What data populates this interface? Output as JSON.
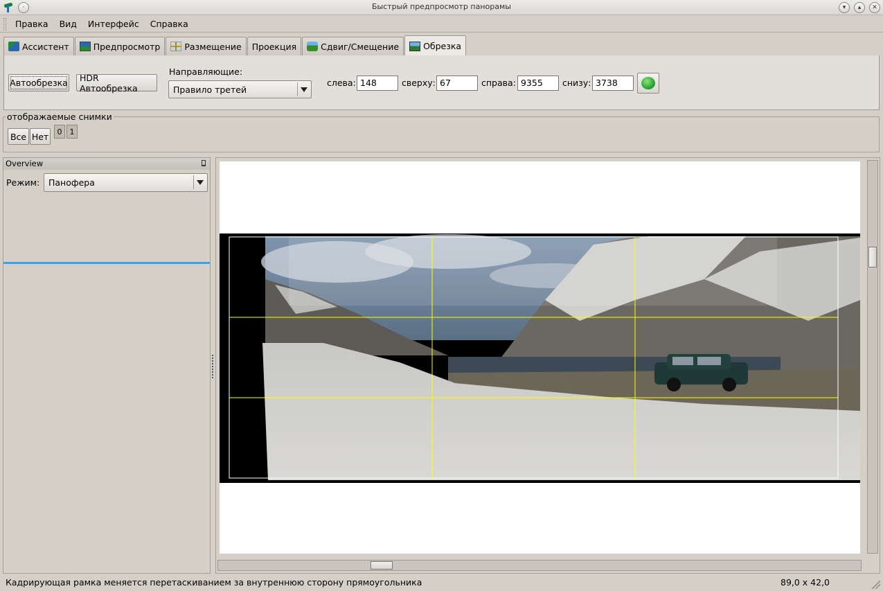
{
  "window": {
    "title": "Быстрый предпросмотр панорамы",
    "app_icon": "hugin-icon",
    "controls": [
      "minimize-icon",
      "maximize-icon",
      "close-icon"
    ]
  },
  "menu": {
    "items": [
      "Правка",
      "Вид",
      "Интерфейс",
      "Справка"
    ]
  },
  "tabs": [
    {
      "label": "Ассистент",
      "icon": "wizard-icon"
    },
    {
      "label": "Предпросмотр",
      "icon": "gl-preview-icon"
    },
    {
      "label": "Размещение",
      "icon": "layout-grid-icon"
    },
    {
      "label": "Проекция",
      "icon": ""
    },
    {
      "label": "Сдвиг/Смещение",
      "icon": "move-icon"
    },
    {
      "label": "Обрезка",
      "icon": "crop-icon",
      "active": true
    }
  ],
  "crop": {
    "autocrop_label": "Автообрезка",
    "hdr_autocrop_label": "HDR Автообрезка",
    "guides_label": "Направляющие:",
    "guides_value": "Правило третей",
    "left_label": "слева:",
    "left_value": "148",
    "top_label": "сверху:",
    "top_value": "67",
    "right_label": "справа:",
    "right_value": "9355",
    "bottom_label": "снизу:",
    "bottom_value": "3738",
    "reset_icon": "green-refresh-icon"
  },
  "displayed_images": {
    "legend": "отображаемые снимки",
    "all_label": "Все",
    "none_label": "Нет",
    "images": [
      "0",
      "1"
    ]
  },
  "overview": {
    "title": "Overview",
    "mode_label": "Режим:",
    "mode_value": "Панофера"
  },
  "status": {
    "message": "Кадрирующая рамка меняется перетаскиванием за внутреннюю сторону прямоугольника",
    "coords": "89,0 x 42,0"
  },
  "colors": {
    "guide_line": "#ffff00",
    "overview_separator": "#3aa3e8"
  }
}
